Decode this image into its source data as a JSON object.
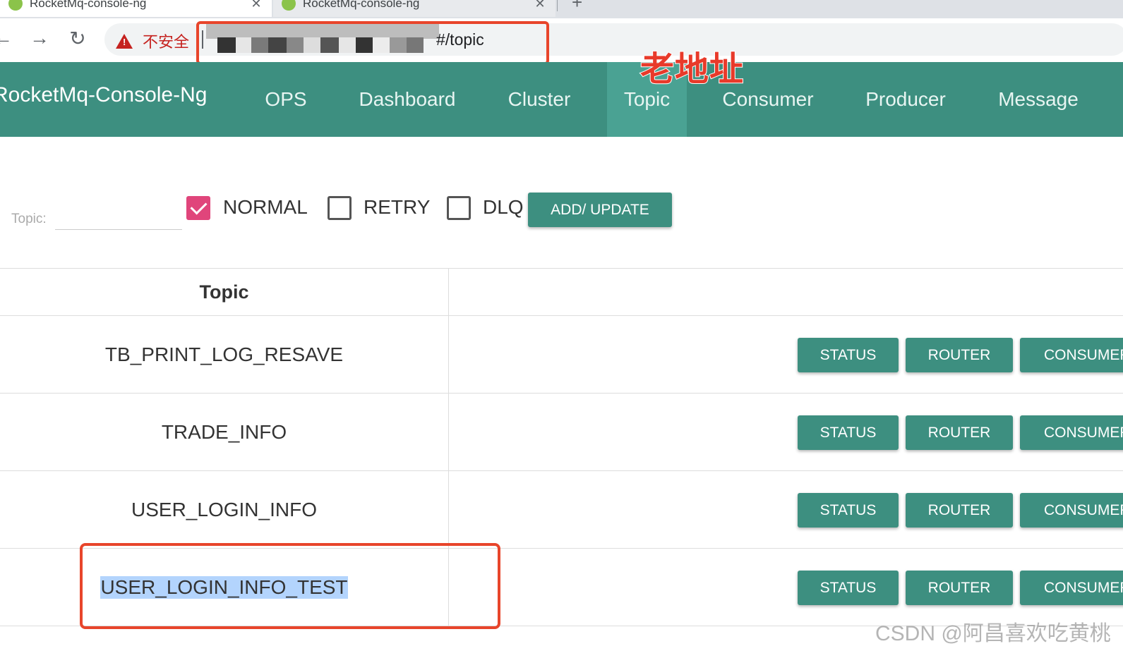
{
  "browser": {
    "tabs": [
      {
        "title": "RocketMq-console-ng",
        "close": "✕"
      },
      {
        "title": "RocketMq-console-ng",
        "close": "✕"
      }
    ],
    "new_tab": "+",
    "security_label": "不安全",
    "url_suffix": "#/topic"
  },
  "annotation_text": "老地址",
  "navbar": {
    "brand": "RocketMq-Console-Ng",
    "items": [
      "OPS",
      "Dashboard",
      "Cluster",
      "Topic",
      "Consumer",
      "Producer",
      "Message"
    ],
    "active": "Topic"
  },
  "filter": {
    "topic_label": "Topic:",
    "topic_value": "",
    "checkboxes": [
      {
        "label": "NORMAL",
        "checked": true
      },
      {
        "label": "RETRY",
        "checked": false
      },
      {
        "label": "DLQ",
        "checked": false
      }
    ],
    "add_button": "ADD/ UPDATE"
  },
  "table": {
    "header": "Topic",
    "rows": [
      {
        "topic": "TB_PRINT_LOG_RESAVE"
      },
      {
        "topic": "TRADE_INFO"
      },
      {
        "topic": "USER_LOGIN_INFO"
      },
      {
        "topic": "USER_LOGIN_INFO_TEST",
        "selected": true
      }
    ],
    "actions": [
      "STATUS",
      "ROUTER",
      "CONSUMER"
    ]
  },
  "watermark": "CSDN @阿昌喜欢吃黄桃",
  "colors": {
    "navbar": "#3d8f80",
    "navbar_active": "#4aa293",
    "button": "#3d8f80",
    "checkbox_checked": "#e0457b",
    "highlight_border": "#e8452b",
    "text_selection": "#b3d4fd"
  }
}
